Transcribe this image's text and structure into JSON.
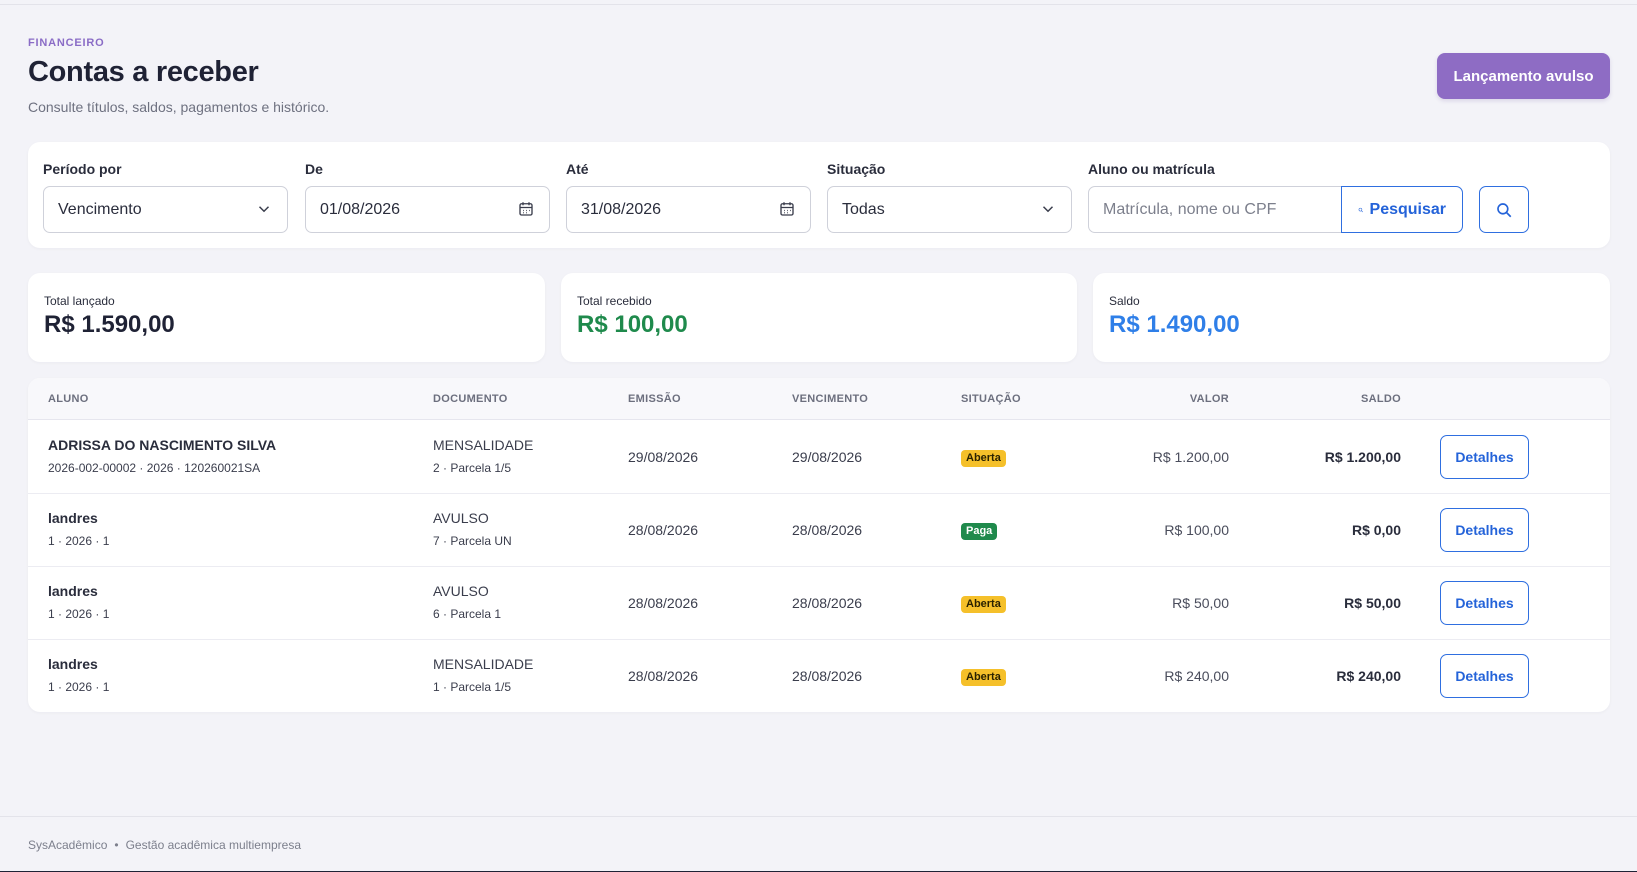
{
  "header": {
    "eyebrow": "FINANCEIRO",
    "title": "Contas a receber",
    "subtitle": "Consulte títulos, saldos, pagamentos e histórico.",
    "action_label": "Lançamento avulso"
  },
  "filters": {
    "periodo_label": "Período por",
    "periodo_value": "Vencimento",
    "de_label": "De",
    "de_value": "01/08/2026",
    "ate_label": "Até",
    "ate_value": "31/08/2026",
    "situacao_label": "Situação",
    "situacao_value": "Todas",
    "aluno_label": "Aluno ou matrícula",
    "aluno_placeholder": "Matrícula, nome ou CPF",
    "search_label": "Pesquisar"
  },
  "stats": {
    "lancado_label": "Total lançado",
    "lancado_value": "R$ 1.590,00",
    "recebido_label": "Total recebido",
    "recebido_value": "R$ 100,00",
    "saldo_label": "Saldo",
    "saldo_value": "R$ 1.490,00"
  },
  "table": {
    "headers": {
      "aluno": "ALUNO",
      "documento": "DOCUMENTO",
      "emissao": "EMISSÃO",
      "vencimento": "VENCIMENTO",
      "situacao": "SITUAÇÃO",
      "valor": "VALOR",
      "saldo": "SALDO"
    },
    "detail_label": "Detalhes",
    "rows": [
      {
        "name": "ADRISSA DO NASCIMENTO SILVA",
        "sub": "2026-002-00002 · 2026 · 120260021SA",
        "doc": "MENSALIDADE",
        "doc_sub": "2 · Parcela 1/5",
        "emissao": "29/08/2026",
        "vencimento": "29/08/2026",
        "status": "Aberta",
        "valor": "R$ 1.200,00",
        "saldo": "R$ 1.200,00"
      },
      {
        "name": "landres",
        "sub": "1 · 2026 · 1",
        "doc": "AVULSO",
        "doc_sub": "7 · Parcela UN",
        "emissao": "28/08/2026",
        "vencimento": "28/08/2026",
        "status": "Paga",
        "valor": "R$ 100,00",
        "saldo": "R$ 0,00"
      },
      {
        "name": "landres",
        "sub": "1 · 2026 · 1",
        "doc": "AVULSO",
        "doc_sub": "6 · Parcela 1",
        "emissao": "28/08/2026",
        "vencimento": "28/08/2026",
        "status": "Aberta",
        "valor": "R$ 50,00",
        "saldo": "R$ 50,00"
      },
      {
        "name": "landres",
        "sub": "1 · 2026 · 1",
        "doc": "MENSALIDADE",
        "doc_sub": "1 · Parcela 1/5",
        "emissao": "28/08/2026",
        "vencimento": "28/08/2026",
        "status": "Aberta",
        "valor": "R$ 240,00",
        "saldo": "R$ 240,00"
      }
    ]
  },
  "footer": {
    "app_name": "SysAcadêmico",
    "separator": "•",
    "tagline": "Gestão acadêmica multiempresa"
  },
  "colors": {
    "accent": "#8e6cc4",
    "link": "#2463d9",
    "received": "#1f8a4c",
    "balance": "#2f7fe8",
    "badge_open": "#f5c02a",
    "badge_paid": "#1f8a4c"
  }
}
